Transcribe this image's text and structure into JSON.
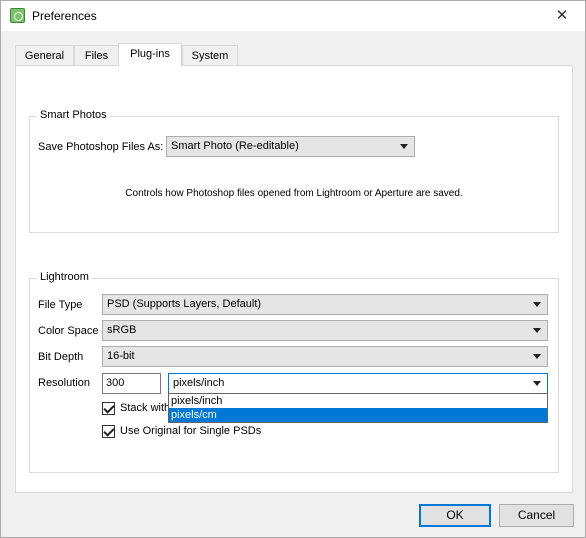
{
  "window": {
    "title": "Preferences",
    "close_glyph": "✕"
  },
  "tabs": [
    {
      "label": "General",
      "active": false
    },
    {
      "label": "Files",
      "active": false
    },
    {
      "label": "Plug-ins",
      "active": true
    },
    {
      "label": "System",
      "active": false
    }
  ],
  "smart_photos": {
    "group_label": "Smart Photos",
    "save_as_label": "Save Photoshop Files As:",
    "save_as_value": "Smart Photo (Re-editable)",
    "note": "Controls how Photoshop files opened from Lightroom or Aperture are saved."
  },
  "lightroom": {
    "group_label": "Lightroom",
    "file_type_label": "File Type",
    "file_type_value": "PSD (Supports Layers, Default)",
    "color_space_label": "Color Space",
    "color_space_value": "sRGB",
    "bit_depth_label": "Bit Depth",
    "bit_depth_value": "16-bit",
    "resolution_label": "Resolution",
    "resolution_value": "300",
    "resolution_unit_value": "pixels/inch",
    "resolution_unit_options": [
      "pixels/inch",
      "pixels/cm"
    ],
    "highlighted_option": "pixels/cm",
    "stack_label": "Stack with",
    "stack_checked": true,
    "use_original_label": "Use Original for Single PSDs",
    "use_original_checked": true
  },
  "buttons": {
    "ok": "OK",
    "cancel": "Cancel"
  },
  "colors": {
    "accent": "#0078d7",
    "highlight": "#0078d7",
    "panel": "#ffffff",
    "window": "#f0f0f0"
  }
}
